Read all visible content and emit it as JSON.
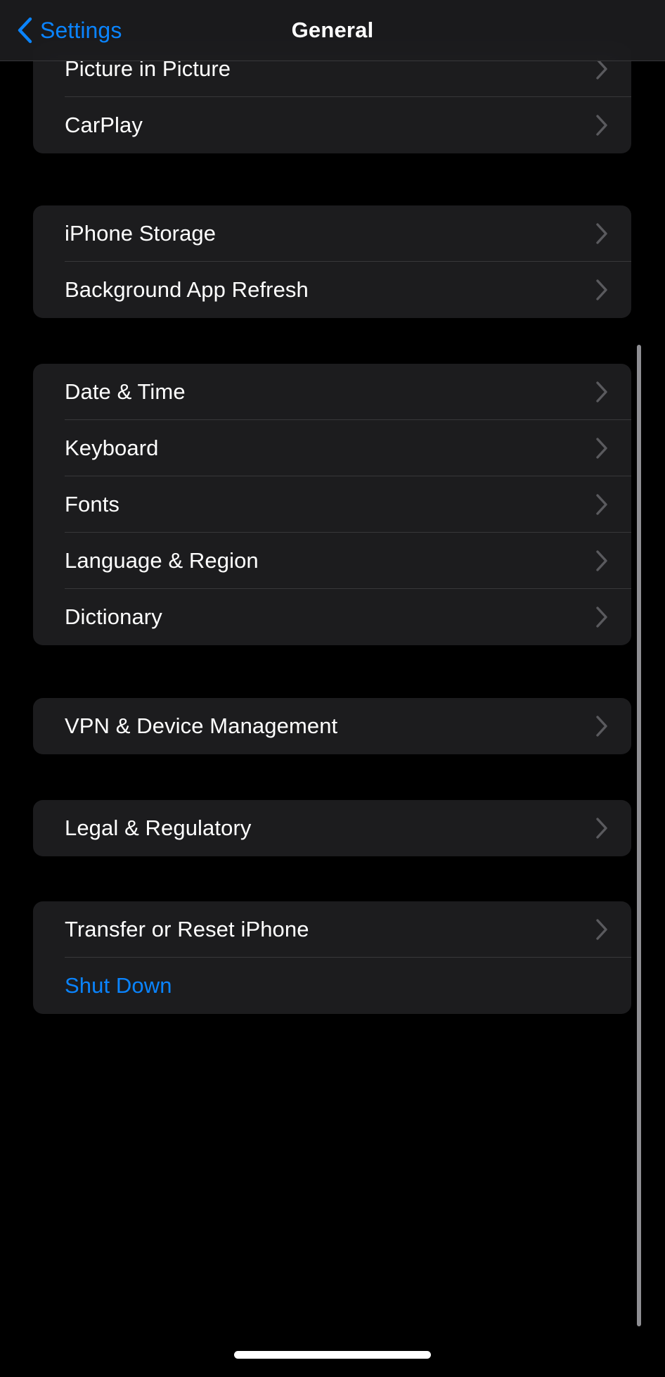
{
  "navbar": {
    "back_label": "Settings",
    "back_icon": "chevron-left-icon",
    "title": "General"
  },
  "colors": {
    "accent_blue": "#0a84ff",
    "card_background": "#1c1c1e",
    "page_background": "#000000",
    "separator": "#38383a",
    "chevron_gray": "#5a5a5e",
    "label_white": "#ffffff",
    "scrollbar": "#8e8e93"
  },
  "groups": [
    {
      "id": "media-group",
      "rows": [
        {
          "label": "Picture in Picture",
          "accessory": "chevron-right-icon",
          "style": "default"
        },
        {
          "label": "CarPlay",
          "accessory": "chevron-right-icon",
          "style": "default"
        }
      ]
    },
    {
      "id": "storage-group",
      "rows": [
        {
          "label": "iPhone Storage",
          "accessory": "chevron-right-icon",
          "style": "default"
        },
        {
          "label": "Background App Refresh",
          "accessory": "chevron-right-icon",
          "style": "default"
        }
      ]
    },
    {
      "id": "localization-group",
      "rows": [
        {
          "label": "Date & Time",
          "accessory": "chevron-right-icon",
          "style": "default"
        },
        {
          "label": "Keyboard",
          "accessory": "chevron-right-icon",
          "style": "default"
        },
        {
          "label": "Fonts",
          "accessory": "chevron-right-icon",
          "style": "default"
        },
        {
          "label": "Language & Region",
          "accessory": "chevron-right-icon",
          "style": "default"
        },
        {
          "label": "Dictionary",
          "accessory": "chevron-right-icon",
          "style": "default"
        }
      ]
    },
    {
      "id": "vpn-group",
      "rows": [
        {
          "label": "VPN & Device Management",
          "accessory": "chevron-right-icon",
          "style": "default"
        }
      ]
    },
    {
      "id": "legal-group",
      "rows": [
        {
          "label": "Legal & Regulatory",
          "accessory": "chevron-right-icon",
          "style": "default"
        }
      ]
    },
    {
      "id": "reset-group",
      "rows": [
        {
          "label": "Transfer or Reset iPhone",
          "accessory": "chevron-right-icon",
          "style": "default"
        },
        {
          "label": "Shut Down",
          "accessory": "none",
          "style": "accent"
        }
      ]
    }
  ]
}
